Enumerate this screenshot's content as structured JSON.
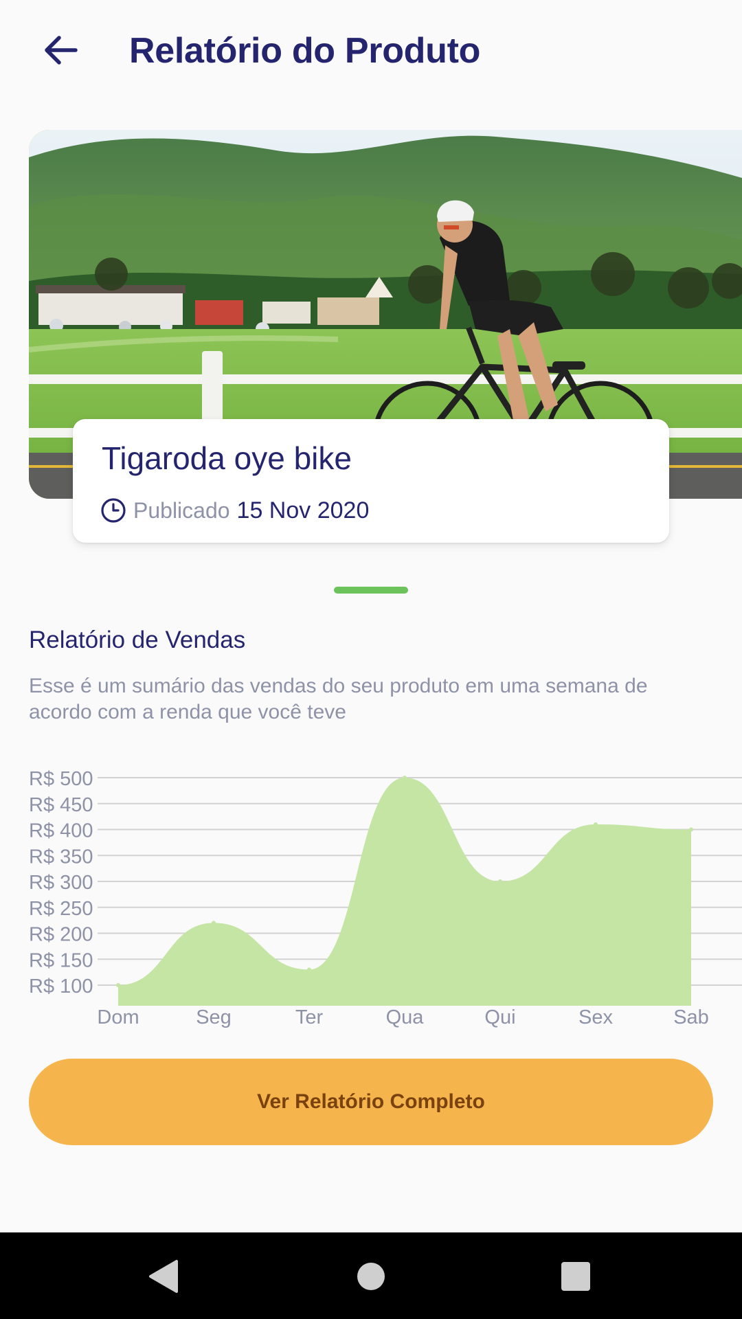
{
  "header": {
    "title": "Relatório do Produto",
    "back_icon": "arrow-left-icon"
  },
  "product": {
    "image": "cyclist-on-road-bike-in-mountain-landscape",
    "name": "Tigaroda oye bike",
    "published_label": "Publicado",
    "published_date": "15 Nov 2020",
    "clock_icon": "clock-icon"
  },
  "report": {
    "title": "Relatório de Vendas",
    "description": "Esse é um sumário das vendas do seu produto em uma semana de acordo com a renda que você teve"
  },
  "chart_data": {
    "type": "area",
    "categories": [
      "Dom",
      "Seg",
      "Ter",
      "Qua",
      "Qui",
      "Sex",
      "Sab"
    ],
    "values": [
      100,
      220,
      130,
      500,
      300,
      410,
      400
    ],
    "y_ticks": [
      "R$ 500",
      "R$ 450",
      "R$ 400",
      "R$ 350",
      "R$ 300",
      "R$ 250",
      "R$ 200",
      "R$ 150",
      "R$ 100"
    ],
    "ylim": [
      100,
      500
    ],
    "grid": true,
    "fill_color": "#c5e5a5",
    "title": "",
    "xlabel": "",
    "ylabel": ""
  },
  "actions": {
    "full_report_label": "Ver Relatório Completo"
  },
  "colors": {
    "primary_text": "#25256f",
    "secondary_text": "#8e92a7",
    "accent_green": "#6cc35c",
    "button": "#f5b54c",
    "button_text": "#7a4210"
  },
  "navigation": {
    "back_icon": "nav-back-icon",
    "home_icon": "nav-home-icon",
    "recents_icon": "nav-recents-icon"
  }
}
